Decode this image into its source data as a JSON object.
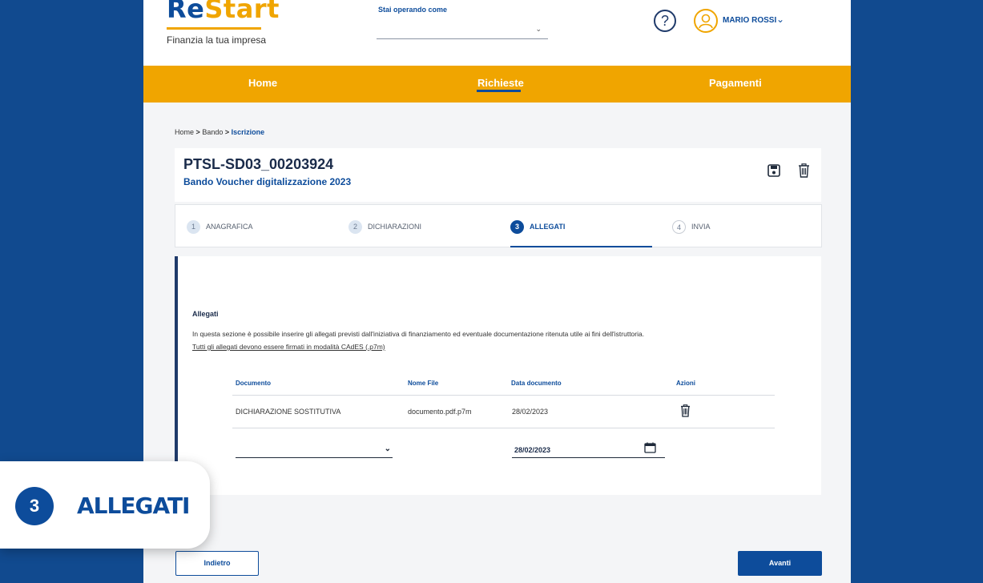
{
  "header": {
    "logo_main": "Re",
    "logo_accent": "Start",
    "tagline": "Finanzia la tua impresa",
    "operando_label": "Stai operando come",
    "user_name": "MARIO ROSSI"
  },
  "nav": {
    "items": [
      "Home",
      "Richieste",
      "Pagamenti"
    ],
    "active": "Richieste"
  },
  "breadcrumb": {
    "home": "Home",
    "sep": ">",
    "bando": "Bando",
    "current": "Iscrizione"
  },
  "pratica": {
    "code": "PTSL-SD03_00203924",
    "bando_name": "Bando Voucher digitalizzazione 2023"
  },
  "steps": [
    {
      "number": "1",
      "label": "ANAGRAFICA"
    },
    {
      "number": "2",
      "label": "DICHIARAZIONI"
    },
    {
      "number": "3",
      "label": "ALLEGATI"
    },
    {
      "number": "4",
      "label": "INVIA"
    }
  ],
  "allegati": {
    "title": "Allegati",
    "description": "In questa sezione è possibile inserire gli allegati previsti dall'iniziativa di finanziamento ed eventuale documentazione ritenuta utile ai fini dell'istruttoria.",
    "link": "Tutti gli allegati devono essere firmati in modalità CAdES (.p7m)",
    "columns": [
      "Documento",
      "Nome File",
      "Data documento",
      "Azioni"
    ],
    "rows": [
      {
        "documento": "DICHIARAZIONE SOSTITUTIVA",
        "nome_file": "documento.pdf.p7m",
        "data": "28/02/2023"
      }
    ],
    "new_row": {
      "documento": "",
      "data": "28/02/2023"
    }
  },
  "buttons": {
    "back": "Indietro",
    "next": "Avanti"
  },
  "overlay": {
    "number": "3",
    "label": "ALLEGATI"
  },
  "colors": {
    "background": "#114a8f",
    "accent": "#f0a500",
    "primary": "#0d4c9b"
  }
}
